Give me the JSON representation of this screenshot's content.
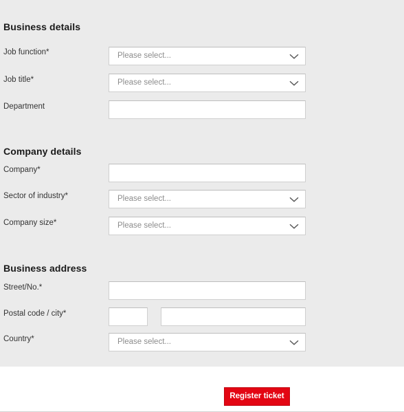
{
  "theme": {
    "page_background": "#ebebeb",
    "footer_background": "#ffffff",
    "field_background": "#ffffff",
    "field_border": "#cfcfcf",
    "heading_color": "#1a1a1a",
    "label_color": "#333333",
    "placeholder_color": "#8c8c8c",
    "accent_color": "#e30613"
  },
  "sections": [
    {
      "heading": "Business details",
      "fields": [
        {
          "label": "Job function*",
          "type": "select",
          "value": "Please select...",
          "icon": "chevron-down-icon"
        },
        {
          "label": "Job title*",
          "type": "select",
          "value": "Please select...",
          "icon": "chevron-down-icon"
        },
        {
          "label": "Department",
          "type": "text",
          "value": "",
          "placeholder": ""
        }
      ]
    },
    {
      "heading": "Company details",
      "fields": [
        {
          "label": "Company*",
          "type": "text",
          "value": "",
          "placeholder": ""
        },
        {
          "label": "Sector of industry*",
          "type": "select",
          "value": "Please select...",
          "icon": "chevron-down-icon"
        },
        {
          "label": "Company size*",
          "type": "select",
          "value": "Please select...",
          "icon": "chevron-down-icon"
        }
      ]
    },
    {
      "heading": "Business address",
      "fields": [
        {
          "label": "Street/No.*",
          "type": "text",
          "value": "",
          "placeholder": ""
        },
        {
          "label": "Postal code / city*",
          "type": "split",
          "postal_value": "",
          "postal_placeholder": "",
          "city_value": "",
          "city_placeholder": ""
        },
        {
          "label": "Country*",
          "type": "select",
          "value": "Please select...",
          "icon": "chevron-down-icon"
        }
      ]
    }
  ],
  "footer": {
    "submit_label": "Register ticket"
  }
}
